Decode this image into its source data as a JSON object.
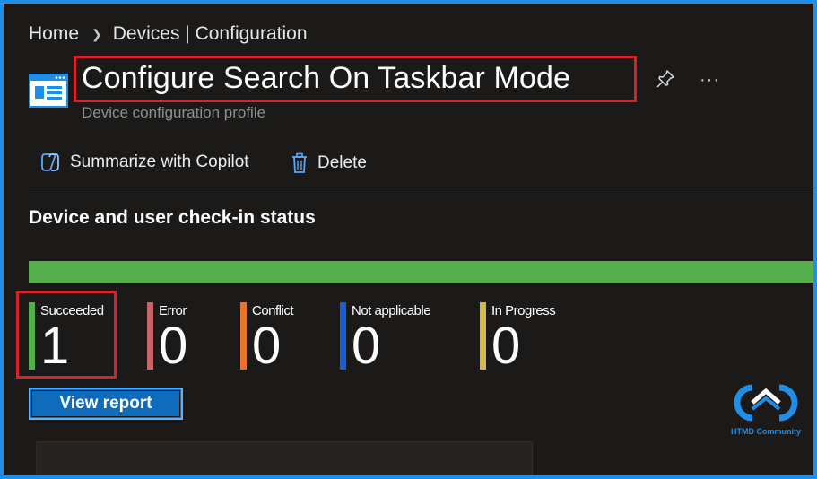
{
  "breadcrumb": {
    "home": "Home",
    "current": "Devices | Configuration"
  },
  "header": {
    "title": "Configure Search On Taskbar Mode",
    "subtitle": "Device configuration profile",
    "more": "···"
  },
  "toolbar": {
    "copilot_label": "Summarize with Copilot",
    "delete_label": "Delete"
  },
  "section": {
    "title": "Device and user check-in status",
    "progress_succeeded_fraction": 1.0
  },
  "stats": [
    {
      "label": "Succeeded",
      "value": "1",
      "color": "#55b04c"
    },
    {
      "label": "Error",
      "value": "0",
      "color": "#c8646a"
    },
    {
      "label": "Conflict",
      "value": "0",
      "color": "#e8742c"
    },
    {
      "label": "Not applicable",
      "value": "0",
      "color": "#1560d6"
    },
    {
      "label": "In Progress",
      "value": "0",
      "color": "#d4b84a"
    }
  ],
  "actions": {
    "view_report": "View report"
  },
  "watermark": {
    "text": "HTMD Community"
  },
  "colors": {
    "highlight_border": "#d6242d",
    "accent_blue": "#0f6cbd",
    "frame_border": "#1f8ee8"
  }
}
